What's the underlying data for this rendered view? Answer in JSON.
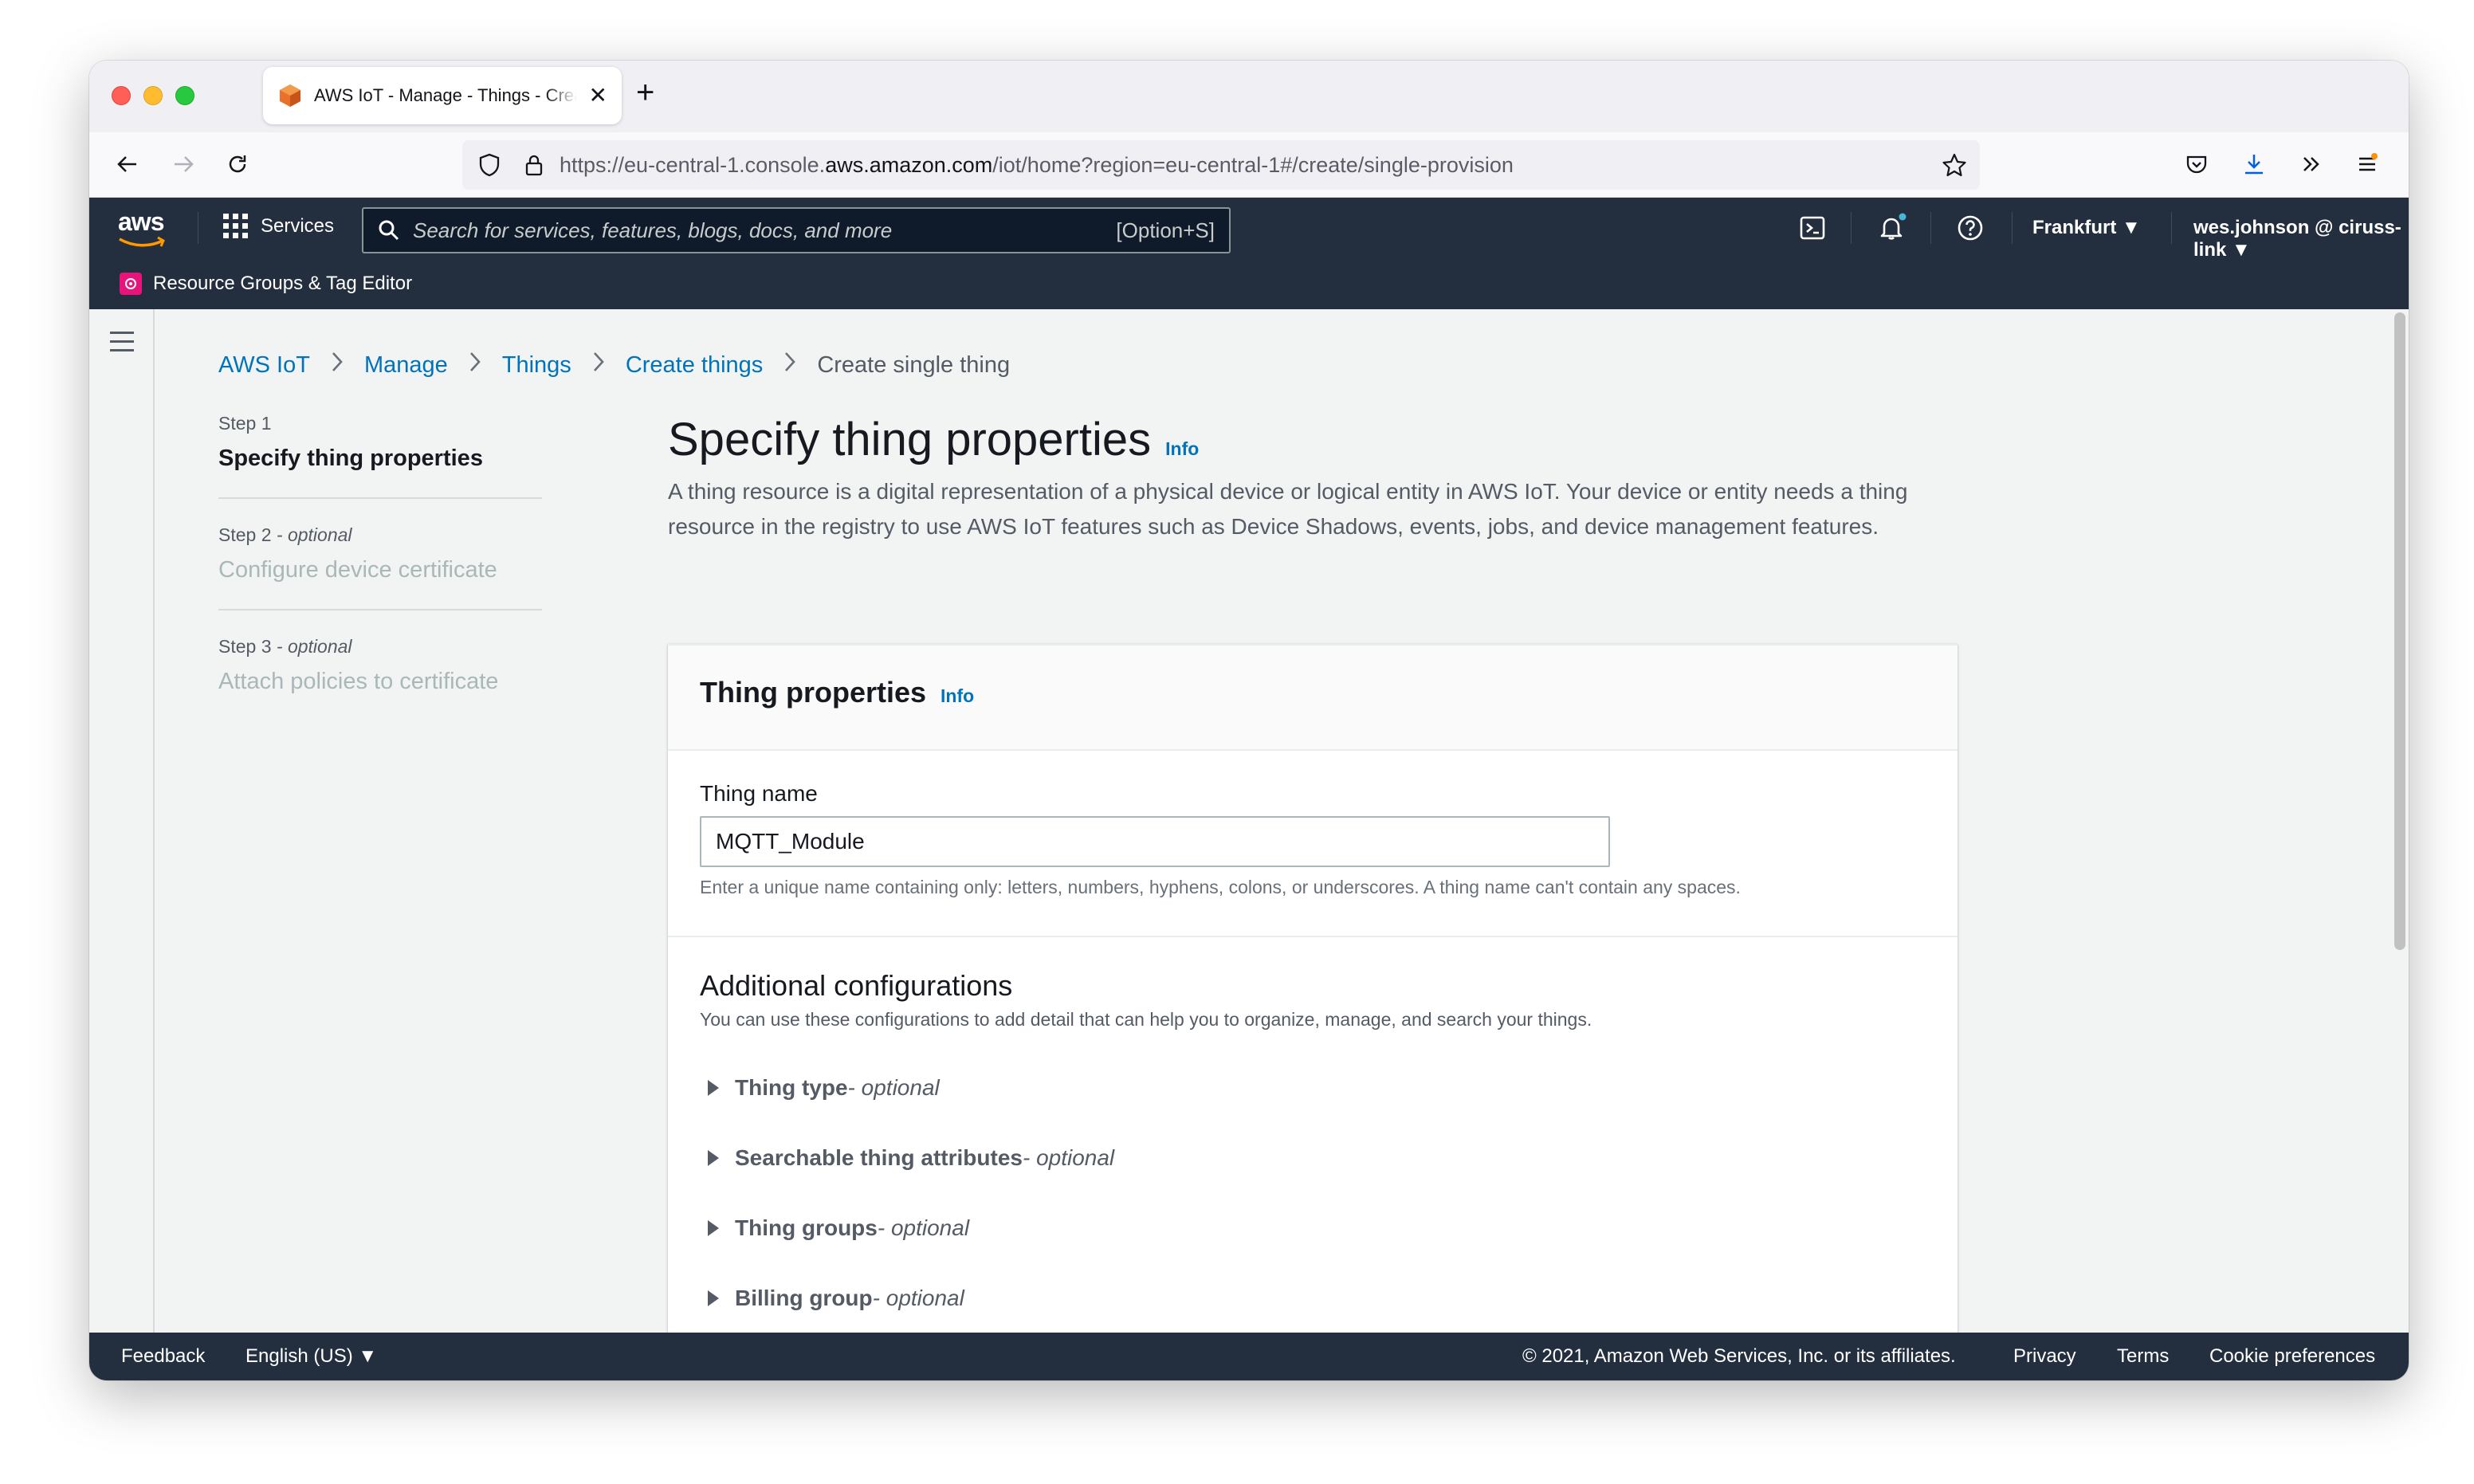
{
  "browser": {
    "tab_title": "AWS IoT - Manage - Things - Create",
    "tab_close": "✕",
    "new_tab": "+",
    "url_prefix": "https://eu-central-1.console.",
    "url_domain": "aws.amazon.com",
    "url_suffix": "/iot/home?region=eu-central-1#/create/single-provision"
  },
  "aws_header": {
    "logo": "aws",
    "services_label": "Services",
    "search_placeholder": "Search for services, features, blogs, docs, and more",
    "search_shortcut": "[Option+S]",
    "region": "Frankfurt ▼",
    "account": "wes.johnson @ ciruss-link ▼",
    "favorite": "Resource Groups & Tag Editor"
  },
  "breadcrumb": {
    "items": [
      "AWS IoT",
      "Manage",
      "Things",
      "Create things"
    ],
    "current": "Create single thing",
    "separator": ">"
  },
  "steps": [
    {
      "label": "Step 1",
      "optional": "",
      "title": "Specify thing properties"
    },
    {
      "label": "Step 2",
      "optional": " - optional",
      "title": "Configure device certificate"
    },
    {
      "label": "Step 3",
      "optional": " - optional",
      "title": "Attach policies to certificate"
    }
  ],
  "main": {
    "title": "Specify thing properties",
    "info": "Info",
    "description": "A thing resource is a digital representation of a physical device or logical entity in AWS IoT. Your device or entity needs a thing resource in the registry to use AWS IoT features such as Device Shadows, events, jobs, and device management features."
  },
  "panel": {
    "title": "Thing properties",
    "info": "Info",
    "thing_name_label": "Thing name",
    "thing_name_value": "MQTT_Module",
    "thing_name_hint": "Enter a unique name containing only: letters, numbers, hyphens, colons, or underscores. A thing name can't contain any spaces.",
    "additional_title": "Additional configurations",
    "additional_desc": "You can use these configurations to add detail that can help you to organize, manage, and search your things.",
    "expanders": [
      {
        "name": "Thing type",
        "suffix": " - optional"
      },
      {
        "name": "Searchable thing attributes",
        "suffix": " - optional"
      },
      {
        "name": "Thing groups",
        "suffix": " - optional"
      },
      {
        "name": "Billing group",
        "suffix": " - optional"
      }
    ]
  },
  "footer": {
    "feedback": "Feedback",
    "language": "English (US) ▼",
    "copyright": "© 2021, Amazon Web Services, Inc. or its affiliates.",
    "privacy": "Privacy",
    "terms": "Terms",
    "cookies": "Cookie preferences"
  },
  "colors": {
    "aws_nav": "#232f3e",
    "link": "#0073bb",
    "page_bg": "#f2f3f3"
  }
}
